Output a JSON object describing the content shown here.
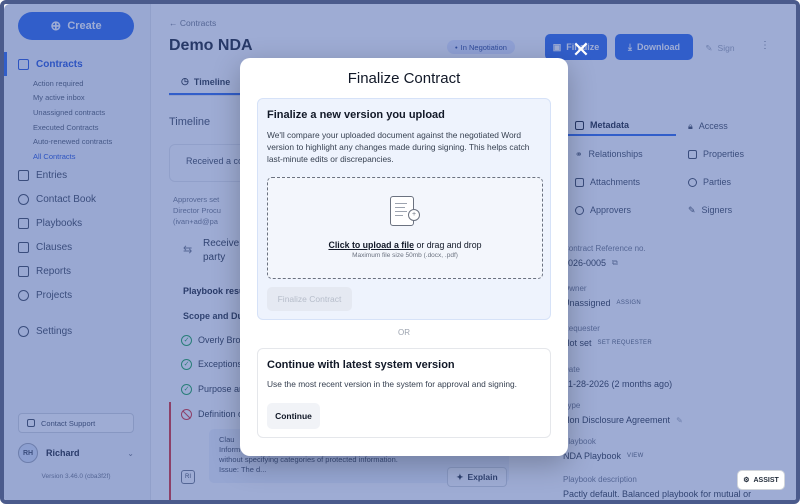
{
  "sidebar": {
    "create_label": "Create",
    "contracts_label": "Contracts",
    "contract_filters": [
      {
        "label": "Action required"
      },
      {
        "label": "My active inbox"
      },
      {
        "label": "Unassigned contracts"
      },
      {
        "label": "Executed Contracts"
      },
      {
        "label": "Auto-renewed contracts"
      },
      {
        "label": "All Contracts"
      }
    ],
    "nav": [
      {
        "label": "Entries",
        "icon": "entries-icon"
      },
      {
        "label": "Contact Book",
        "icon": "contacts-icon"
      },
      {
        "label": "Playbooks",
        "icon": "playbooks-icon"
      },
      {
        "label": "Clauses",
        "icon": "clauses-icon"
      },
      {
        "label": "Reports",
        "icon": "reports-icon"
      },
      {
        "label": "Projects",
        "icon": "projects-icon"
      }
    ],
    "settings_label": "Settings",
    "contact_support_label": "Contact Support",
    "user": {
      "initials": "RH",
      "name": "Richard"
    },
    "version": "Version 3.46.0 (cba3f2f)"
  },
  "header": {
    "breadcrumb": "Contracts",
    "title": "Demo NDA",
    "status": "In Negotiation",
    "finalize_label": "Finalize",
    "download_label": "Download",
    "sign_label": "Sign",
    "more_label": "⋮"
  },
  "main": {
    "tab_timeline": "Timeline",
    "timeline_heading": "Timeline",
    "timeline_card_text": "Received a co",
    "approvers_line1": "Approvers set",
    "approvers_line2": "Director Procu",
    "approvers_line3": "(ivan+ad@pa",
    "received_line1": "Receive",
    "received_line2": "party",
    "playbook_results": "Playbook resu",
    "scope_heading": "Scope and Dur",
    "checks": [
      {
        "label": "Overly Bro"
      },
      {
        "label": "Exceptions"
      },
      {
        "label": "Purpose ar"
      }
    ],
    "definition_label": "Definition o",
    "issue_line1": "Clau",
    "issue_line2": "Inform",
    "issue_line3": "without specifying categories of protected information.",
    "issue_line4": "Issue: The d...",
    "issue_avatar": "RI",
    "explain_label": "Explain"
  },
  "right_panel": {
    "tabs": [
      {
        "label": "Metadata",
        "icon": "metadata-icon",
        "active": true
      },
      {
        "label": "Access",
        "icon": "lock-icon",
        "active": false
      },
      {
        "label": "Relationships",
        "icon": "link-icon",
        "active": false
      },
      {
        "label": "Properties",
        "icon": "properties-icon",
        "active": false
      },
      {
        "label": "Attachments",
        "icon": "attachment-icon",
        "active": false
      },
      {
        "label": "Parties",
        "icon": "parties-icon",
        "active": false
      },
      {
        "label": "Approvers",
        "icon": "approvers-icon",
        "active": false
      },
      {
        "label": "Signers",
        "icon": "pen-icon",
        "active": false
      }
    ],
    "fields": {
      "reference_label": "Contract Reference no.",
      "reference_value": "2026-0005",
      "owner_label": "Owner",
      "owner_value": "Unassigned",
      "owner_action": "ASSIGN",
      "requester_label": "Requester",
      "requester_value": "Not set",
      "requester_action": "SET REQUESTER",
      "date_label": "Date",
      "date_value": "01-28-2026 (2 months ago)",
      "type_label": "Type",
      "type_value": "Non Disclosure Agreement",
      "playbook_label": "Playbook",
      "playbook_value": "NDA Playbook",
      "playbook_action": "VIEW",
      "playbook_desc_label": "Playbook description",
      "playbook_desc_value": "Pactly default. Balanced playbook for mutual or"
    }
  },
  "assist_label": "ASSIST",
  "modal": {
    "title": "Finalize Contract",
    "close_label": "✕",
    "upload_heading": "Finalize a new version you upload",
    "upload_description": "We'll compare your uploaded document against the negotiated Word version to highlight any changes made during signing. This helps catch last-minute edits or discrepancies.",
    "upload_link": "Click to upload a file",
    "upload_or_drag": " or drag and drop",
    "upload_hint": "Maximum file size 50mb (.docx, .pdf)",
    "finalize_button": "Finalize Contract",
    "or_label": "OR",
    "latest_heading": "Continue with latest system version",
    "latest_description": "Use the most recent version in the system for approval and signing.",
    "continue_button": "Continue"
  },
  "colors": {
    "accent": "#2563eb",
    "overlay": "#3e5aaa",
    "upload_card_bg": "#eef3fd"
  }
}
